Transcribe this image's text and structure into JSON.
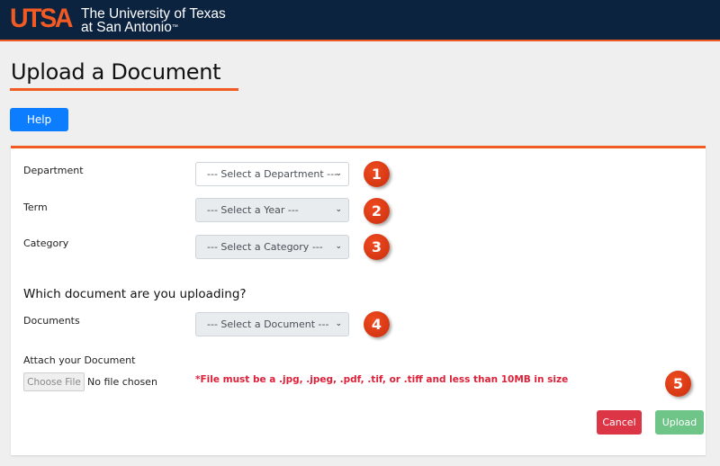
{
  "header": {
    "logo_text": "UTSA",
    "university_line1": "The University of Texas",
    "university_line2": "at San Antonio",
    "trademark": "™"
  },
  "page": {
    "title": "Upload a Document",
    "help_label": "Help"
  },
  "form": {
    "fields": [
      {
        "label": "Department",
        "placeholder": "--- Select a Department ---",
        "step": "1"
      },
      {
        "label": "Term",
        "placeholder": "--- Select a Year ---",
        "step": "2"
      },
      {
        "label": "Category",
        "placeholder": "--- Select a Category ---",
        "step": "3"
      }
    ],
    "section_heading": "Which document are you uploading?",
    "documents": {
      "label": "Documents",
      "placeholder": "--- Select a Document ---",
      "step": "4"
    },
    "attach": {
      "label": "Attach your Document",
      "choose_file_label": "Choose File",
      "file_status": "No file chosen",
      "note": "*File must be a .jpg, .jpeg, .pdf, .tif, or .tiff and less than 10MB in size"
    },
    "upload_step": "5",
    "cancel_label": "Cancel",
    "upload_label": "Upload"
  },
  "colors": {
    "brand_navy": "#0c2340",
    "brand_orange": "#f15a22",
    "help_blue": "#0d7dff",
    "cancel_red": "#dc3545",
    "upload_green": "#6fc587",
    "note_red": "#dc2139"
  },
  "icons": {
    "select_arrow": "chevron-down-icon",
    "step_badge": "numbered-step-badge"
  }
}
